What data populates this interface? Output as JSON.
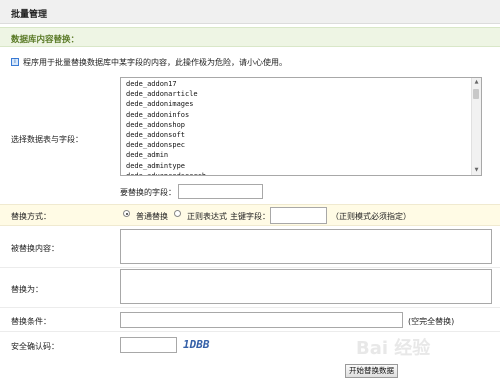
{
  "header": {
    "title": "批量管理"
  },
  "section": {
    "title": "数据库内容替换："
  },
  "info": {
    "text": "程序用于批量替换数据库中某字段的内容，此操作极为危险，请小心使用。"
  },
  "select_table": {
    "label": "选择数据表与字段：",
    "items": [
      "dede_addon17",
      "dede_addonarticle",
      "dede_addonimages",
      "dede_addoninfos",
      "dede_addonshop",
      "dede_addonsoft",
      "dede_addonspec",
      "dede_admin",
      "dede_admintype",
      "dede_advancedsearch"
    ]
  },
  "field_to_replace": {
    "label": "要替换的字段：",
    "value": ""
  },
  "replace_mode": {
    "label": "替换方式：",
    "option_normal": "普通替换",
    "option_regex": "正则表达式",
    "primary_key_label": "主键字段：",
    "primary_key_value": "",
    "regex_note": "（正则模式必须指定）",
    "selected": "普通替换"
  },
  "replaced_content": {
    "label": "被替换内容：",
    "value": ""
  },
  "replace_with": {
    "label": "替换为：",
    "value": ""
  },
  "replace_condition": {
    "label": "替换条件：",
    "value": "",
    "note": "(空完全替换)"
  },
  "captcha": {
    "label": "安全确认码：",
    "value": "",
    "code": "1DBB"
  },
  "submit": {
    "label": "开始替换数据"
  },
  "watermark": {
    "text": "Bai 经验"
  }
}
